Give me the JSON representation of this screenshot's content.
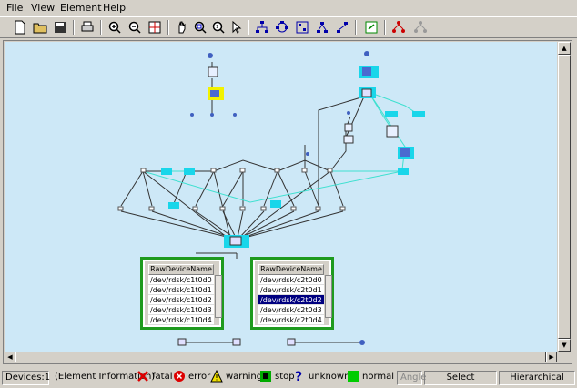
{
  "menubar": {
    "items": [
      {
        "label": "File"
      },
      {
        "label": "View"
      },
      {
        "label": "Element"
      },
      {
        "label": "Help"
      }
    ]
  },
  "tables": [
    {
      "header": "RawDeviceName",
      "rows": [
        "/dev/rdsk/c1t0d0",
        "/dev/rdsk/c1t0d1",
        "/dev/rdsk/c1t0d2",
        "/dev/rdsk/c1t0d3",
        "/dev/rdsk/c1t0d4"
      ],
      "selected_index": -1
    },
    {
      "header": "RawDeviceName",
      "rows": [
        "/dev/rdsk/c2t0d0",
        "/dev/rdsk/c2t0d1",
        "/dev/rdsk/c2t0d2",
        "/dev/rdsk/c2t0d3",
        "/dev/rdsk/c2t0d4"
      ],
      "selected_index": 2
    }
  ],
  "status": {
    "devices": "Devices:1",
    "element_info": "(Element Information)",
    "legend": [
      {
        "label": "fatal",
        "icon": "red-x-icon"
      },
      {
        "label": "error",
        "icon": "red-circle-icon"
      },
      {
        "label": "warning",
        "icon": "yellow-triangle-icon"
      },
      {
        "label": "stop",
        "icon": "green-square-icon"
      },
      {
        "label": "unknown",
        "icon": "blue-question-icon"
      },
      {
        "label": "normal",
        "icon": "green-block-icon"
      }
    ],
    "angle": "Angle",
    "select": "Select",
    "layout": "Hierarchical"
  },
  "colors": {
    "canvas_bg": "#cde8f7",
    "node_cyan": "#19d6ea",
    "node_highlight": "#f2f200",
    "table_border": "#1e9a1e",
    "link_dark": "#333333",
    "link_cyan": "#3fe0d0"
  }
}
